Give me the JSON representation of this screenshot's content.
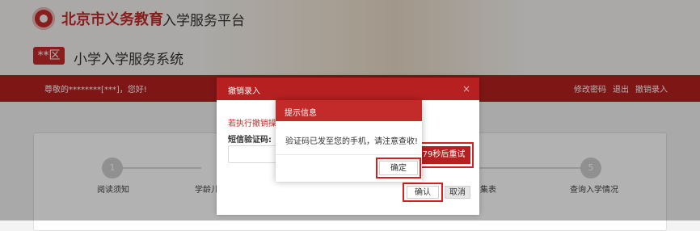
{
  "header": {
    "platform_title_red": "北京市义务教育",
    "platform_title_dark": "入学服务平台",
    "district_badge": "**区",
    "system_title": "小学入学服务系统"
  },
  "navbar": {
    "greeting": "尊敬的********[***]，您好!",
    "links": [
      "修改密码",
      "退出",
      "撤销录入"
    ]
  },
  "steps": [
    {
      "number": "1",
      "label": "阅读须知"
    },
    {
      "number": "",
      "label": "学龄儿"
    },
    {
      "number": "",
      "label": "集表"
    },
    {
      "number": "5",
      "label": "查询入学情况"
    }
  ],
  "outer_dialog": {
    "title": "撤销录入",
    "close_glyph": "×",
    "warning_text": "若执行撤销操作",
    "sms_label": "短信验证码:",
    "sms_value": "",
    "resend_label": "79秒后重试",
    "confirm_label": "确认",
    "cancel_label": "取消"
  },
  "inner_dialog": {
    "title": "提示信息",
    "message": "验证码已发至您的手机，请注意查收!",
    "ok_label": "确定"
  },
  "colors": {
    "brand_red": "#b72020",
    "highlight_red": "#d42222"
  }
}
